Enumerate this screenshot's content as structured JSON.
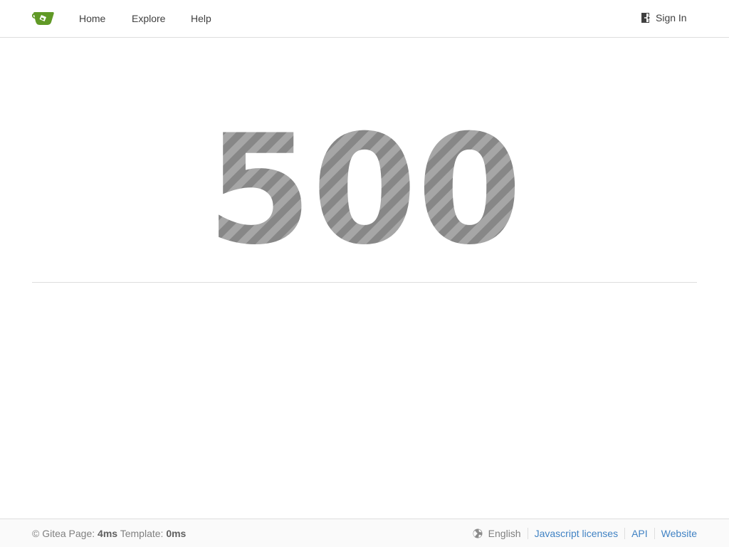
{
  "navbar": {
    "logo_icon": "gitea-teacup-icon",
    "items": [
      {
        "label": "Home"
      },
      {
        "label": "Explore"
      },
      {
        "label": "Help"
      }
    ],
    "signin_label": "Sign In",
    "signin_icon": "sign-in-icon"
  },
  "error": {
    "code": "500"
  },
  "footer": {
    "copyright_prefix": "© Gitea Page:",
    "page_time": "4ms",
    "template_label": "Template:",
    "template_time": "0ms",
    "language": "English",
    "language_icon": "globe-icon",
    "links": [
      {
        "label": "Javascript licenses"
      },
      {
        "label": "API"
      },
      {
        "label": "Website"
      }
    ],
    "link_color": "#4183c4"
  },
  "colors": {
    "brand_green": "#609926",
    "error_text_light": "#a6a6a6",
    "error_text_dark": "#8a8a8a",
    "border": "#dedede"
  }
}
